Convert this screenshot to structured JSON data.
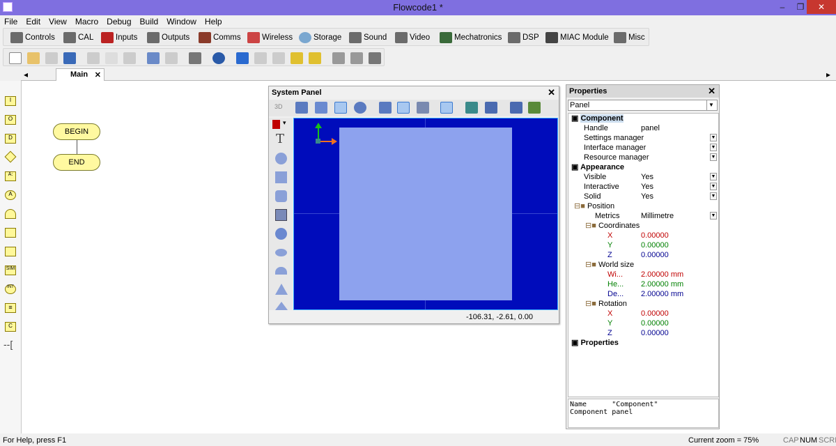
{
  "window": {
    "title": "Flowcode1 *",
    "minimize": "‒",
    "maximize": "❐",
    "close": "✕"
  },
  "menu": [
    "File",
    "Edit",
    "View",
    "Macro",
    "Debug",
    "Build",
    "Window",
    "Help"
  ],
  "component_toolbar": [
    "Controls",
    "CAL",
    "Inputs",
    "Outputs",
    "Comms",
    "Wireless",
    "Storage",
    "Sound",
    "Video",
    "Mechatronics",
    "DSP",
    "MIAC Module",
    "Misc"
  ],
  "tabs": {
    "left_arrow": "◂",
    "right_arrow": "▸",
    "main_label": "Main",
    "main_close": "✕"
  },
  "flowchart": {
    "begin": "BEGIN",
    "end": "END"
  },
  "left_icons": [
    "I",
    "O",
    "D",
    "",
    "A:",
    "A",
    "",
    "",
    "",
    "SIM",
    "INT",
    "≡",
    "C"
  ],
  "system_panel": {
    "title": "System Panel",
    "close": "✕",
    "tb_3d": "3D",
    "coords": "-106.31, -2.61, 0.00",
    "text_tool": "T"
  },
  "properties": {
    "title": "Properties",
    "close": "✕",
    "selector_value": "Panel",
    "component_header": "Component",
    "handle_label": "Handle",
    "handle_value": "panel",
    "settings_manager": "Settings manager",
    "interface_manager": "Interface manager",
    "resource_manager": "Resource manager",
    "appearance_header": "Appearance",
    "visible_label": "Visible",
    "visible_value": "Yes",
    "interactive_label": "Interactive",
    "interactive_value": "Yes",
    "solid_label": "Solid",
    "solid_value": "Yes",
    "position_header": "Position",
    "metrics_label": "Metrics",
    "metrics_value": "Millimetre",
    "coordinates_header": "Coordinates",
    "coord_x_label": "X",
    "coord_x": "0.00000",
    "coord_y_label": "Y",
    "coord_y": "0.00000",
    "coord_z_label": "Z",
    "coord_z": "0.00000",
    "world_size_header": "World size",
    "width_label": "Wi...",
    "width_value": "2.00000 mm",
    "height_label": "He...",
    "height_value": "2.00000 mm",
    "depth_label": "De...",
    "depth_value": "2.00000 mm",
    "rotation_header": "Rotation",
    "rot_x_label": "X",
    "rot_x": "0.00000",
    "rot_y_label": "Y",
    "rot_y": "0.00000",
    "rot_z_label": "Z",
    "rot_z": "0.00000",
    "properties_header": "Properties",
    "info_line1": "Name      \"Component\"",
    "info_line2": "Component panel"
  },
  "status": {
    "help": "For Help, press F1",
    "zoom": "Current zoom = 75%",
    "cap": "CAP",
    "num": "NUM",
    "scrl": "SCRL"
  },
  "colors": {
    "titlebar": "#7f6fe0",
    "viewport": "#000cbb",
    "panel": "#8da2ee",
    "node_fill": "#fff9a0",
    "x_red": "#c00000",
    "y_green": "#008000",
    "z_blue": "#000090"
  }
}
